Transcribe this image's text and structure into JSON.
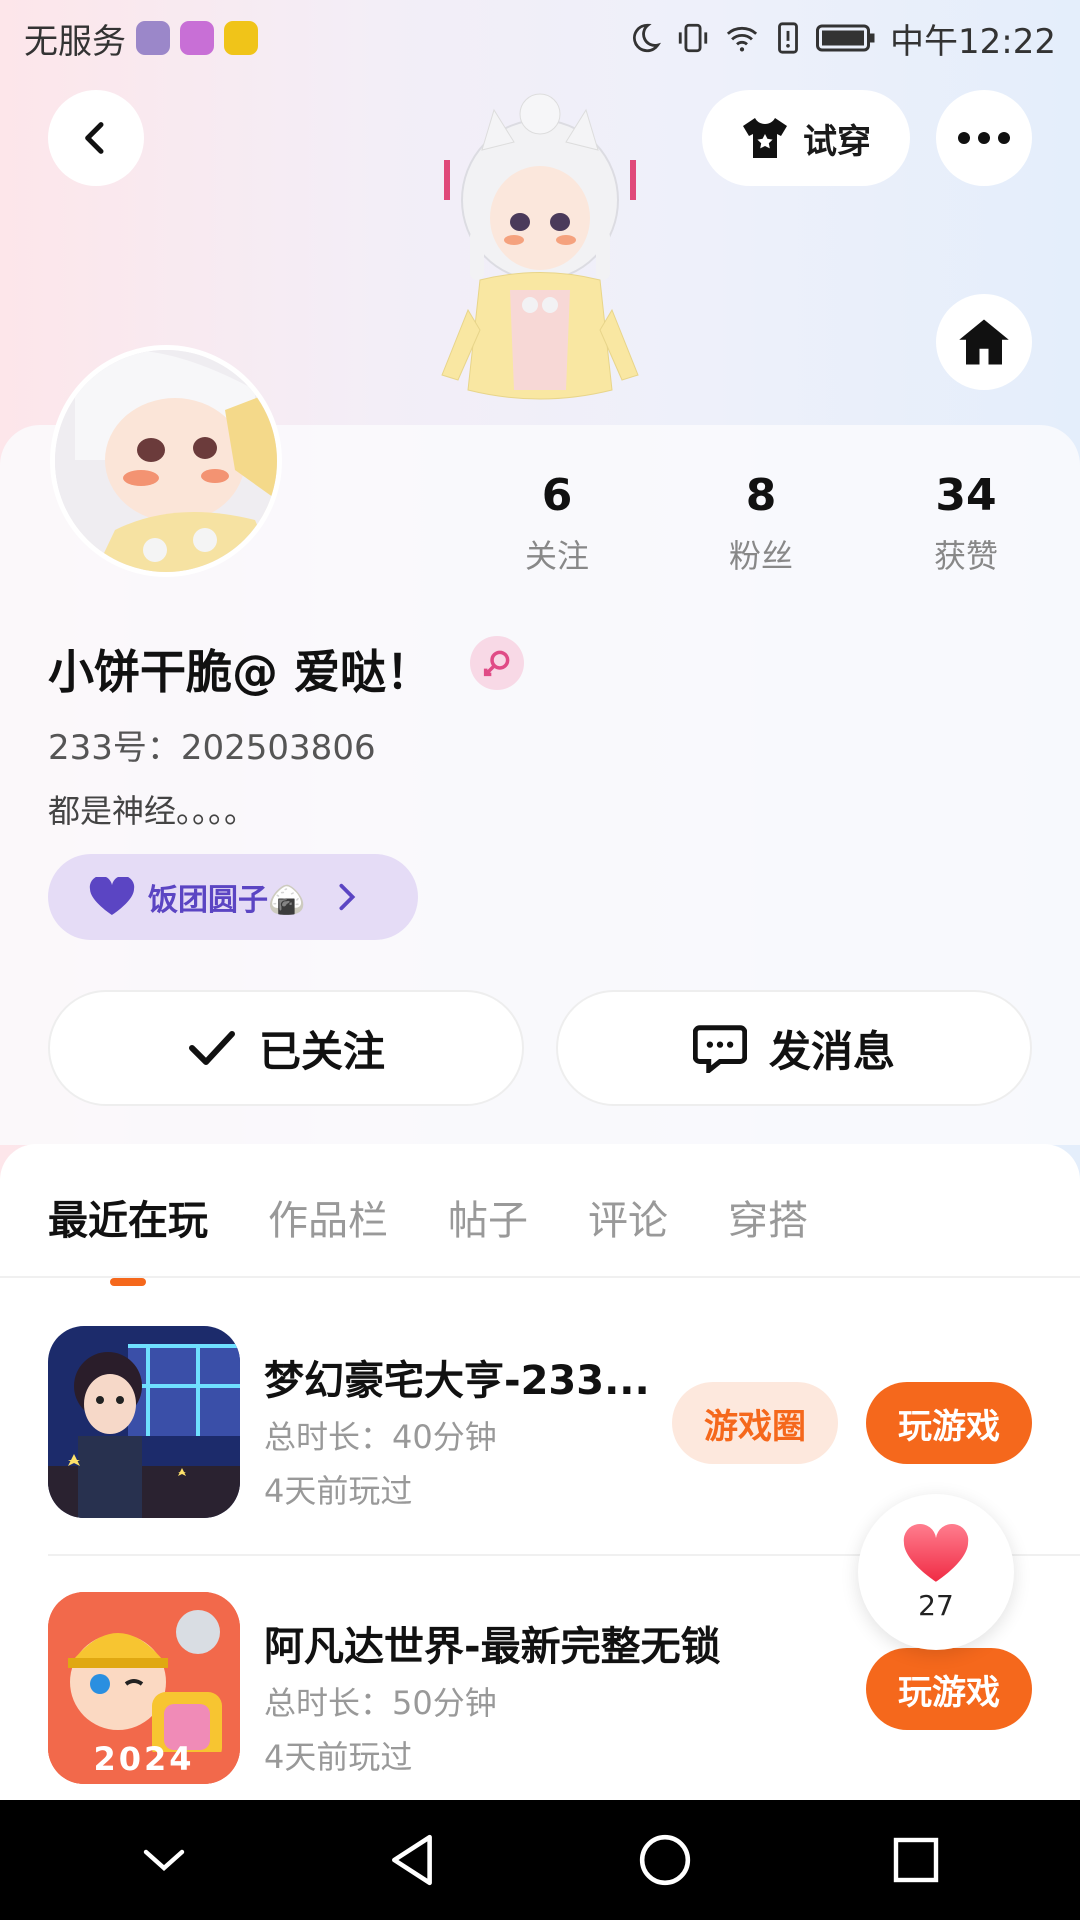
{
  "status_bar": {
    "carrier": "无服务",
    "time": "中午12:22"
  },
  "header": {
    "try_on_label": "试穿"
  },
  "profile": {
    "name": "小饼干脆@  爱哒！",
    "uid": "233号：202503806",
    "bio": "都是神经。。。。",
    "club": "饭团圆子🍙",
    "stats": [
      {
        "num": "6",
        "label": "关注"
      },
      {
        "num": "8",
        "label": "粉丝"
      },
      {
        "num": "34",
        "label": "获赞"
      }
    ]
  },
  "actions": {
    "follow_label": "已关注",
    "message_label": "发消息"
  },
  "tabs": [
    "最近在玩",
    "作品栏",
    "帖子",
    "评论",
    "穿搭"
  ],
  "games": [
    {
      "title": "梦幻豪宅大亨-233...",
      "duration": "总时长：40分钟",
      "last_played": "4天前玩过",
      "circle_label": "游戏圈",
      "play_label": "玩游戏"
    },
    {
      "title": "阿凡达世界-最新完整无锁",
      "duration": "总时长：50分钟",
      "last_played": "4天前玩过",
      "play_label": "玩游戏",
      "icon_badge": "2024"
    }
  ],
  "like_float": {
    "count": "27"
  },
  "colors": {
    "accent": "#f5681c",
    "club_text": "#5b45c3",
    "club_bg": "#e5dcf6"
  }
}
